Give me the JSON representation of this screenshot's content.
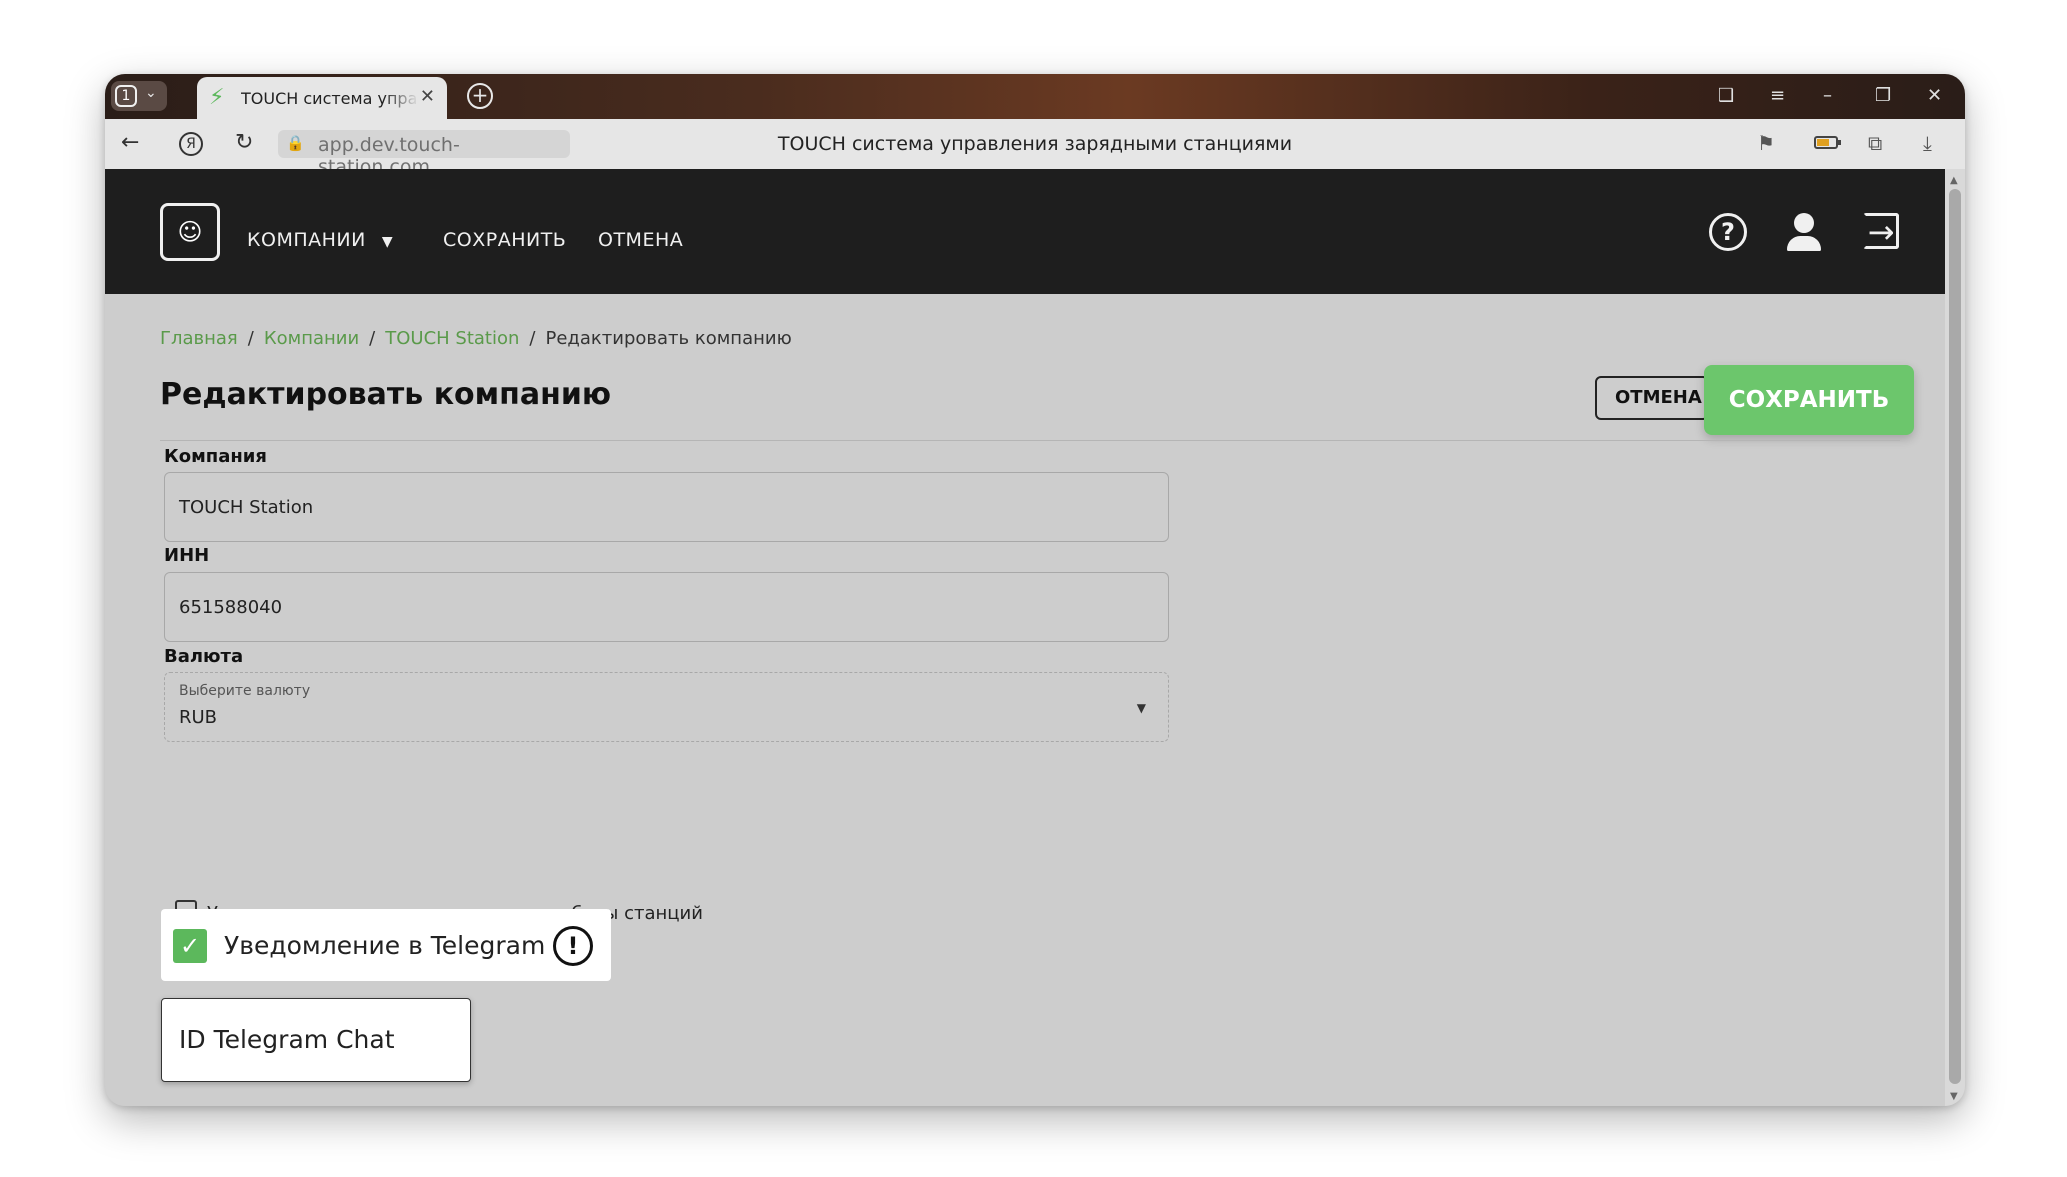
{
  "browser": {
    "tab_count": "1",
    "active_tab_title": "TOUCH система управления зарядными станциями",
    "url": "app.dev.touch-station.com",
    "page_title": "TOUCH система управления зарядными станциями"
  },
  "header": {
    "nav": {
      "companies": "КОМПАНИИ",
      "save": "СОХРАНИТЬ",
      "cancel": "ОТМЕНА"
    }
  },
  "breadcrumb": {
    "home": "Главная",
    "companies": "Компании",
    "company": "TOUCH Station",
    "current": "Редактировать компанию"
  },
  "page": {
    "title": "Редактировать компанию",
    "cancel_label": "ОТМЕНА",
    "save_label": "СОХРАНИТЬ"
  },
  "form": {
    "company": {
      "label": "Компания",
      "value": "TOUCH Station"
    },
    "inn": {
      "label": "ИНН",
      "value": "651588040"
    },
    "currency": {
      "label": "Валюта",
      "placeholder": "Выберите валюту",
      "value": "RUB"
    },
    "email_notify_label": "Уведомление на почту о состоянии работы станций",
    "telegram_notify": {
      "label": "Уведомление в Telegram",
      "checked": true
    },
    "telegram_chat": {
      "value": "ID Telegram Chat"
    }
  },
  "colors": {
    "accent_green": "#6cc66c",
    "link_green": "#5a9a4a",
    "header_bg": "#1e1e1e"
  },
  "icons": [
    "bolt-icon",
    "close-icon",
    "plus-icon",
    "back-icon",
    "yandex-icon",
    "reload-icon",
    "lock-icon",
    "bookmark-icon",
    "battery-icon",
    "share-icon",
    "download-icon",
    "company-logo-icon",
    "caret-down-icon",
    "help-icon",
    "user-icon",
    "logout-icon",
    "check-icon",
    "warning-icon"
  ]
}
